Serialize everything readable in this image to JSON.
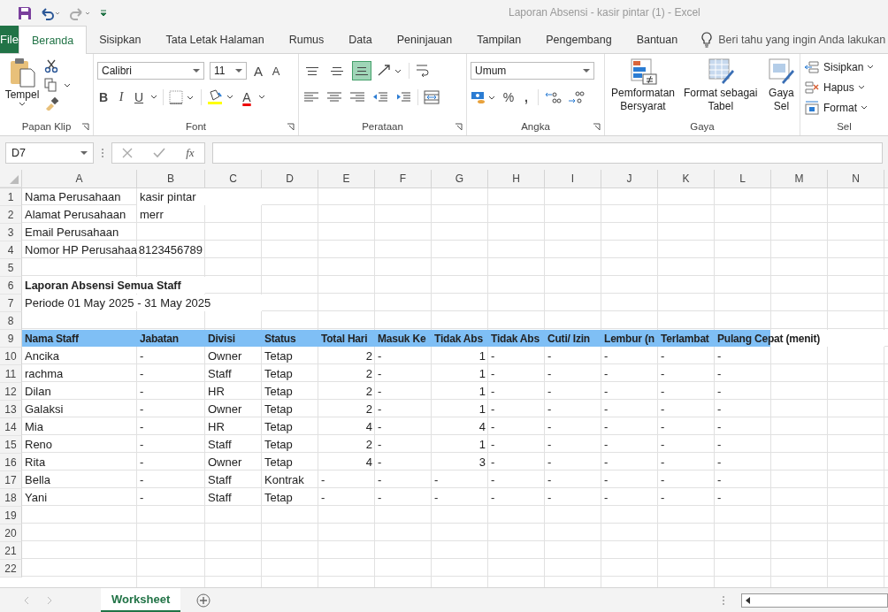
{
  "window": {
    "title": "Laporan Absensi - kasir pintar (1)  -  Excel"
  },
  "ribbon_tabs": [
    {
      "label": "File",
      "kind": "file",
      "selected": false
    },
    {
      "label": "Beranda",
      "kind": "tab",
      "selected": true
    },
    {
      "label": "Sisipkan",
      "kind": "tab",
      "selected": false
    },
    {
      "label": "Tata Letak Halaman",
      "kind": "tab",
      "selected": false
    },
    {
      "label": "Rumus",
      "kind": "tab",
      "selected": false
    },
    {
      "label": "Data",
      "kind": "tab",
      "selected": false
    },
    {
      "label": "Peninjauan",
      "kind": "tab",
      "selected": false
    },
    {
      "label": "Tampilan",
      "kind": "tab",
      "selected": false
    },
    {
      "label": "Pengembang",
      "kind": "tab",
      "selected": false
    },
    {
      "label": "Bantuan",
      "kind": "tab",
      "selected": false
    }
  ],
  "tell_me": {
    "placeholder": "Beri tahu yang ingin Anda lakukan"
  },
  "clipboard": {
    "label": "Papan Klip",
    "paste": "Tempel"
  },
  "font": {
    "label": "Font",
    "family": "Calibri",
    "size": "11",
    "grow": "A",
    "shrink": "A",
    "bold": "B",
    "italic": "I",
    "underline": "U",
    "font_color": "A"
  },
  "alignment": {
    "label": "Perataan",
    "vertical": [
      {
        "kind": "top",
        "selected": false
      },
      {
        "kind": "middle",
        "selected": false
      },
      {
        "kind": "bottom",
        "selected": true
      }
    ]
  },
  "number": {
    "label": "Angka",
    "format": "Umum",
    "percent": "%",
    "comma": ","
  },
  "styles": {
    "label": "Gaya",
    "buttons": [
      {
        "kind": "conditional",
        "lines": [
          "Pemformatan",
          "Bersyarat"
        ]
      },
      {
        "kind": "table",
        "lines": [
          "Format sebagai",
          "Tabel"
        ]
      },
      {
        "kind": "cell",
        "lines": [
          "Gaya",
          "Sel"
        ]
      }
    ]
  },
  "cells_group": {
    "label": "Sel",
    "buttons": [
      {
        "kind": "insert",
        "label": "Sisipkan"
      },
      {
        "kind": "delete",
        "label": "Hapus"
      },
      {
        "kind": "format",
        "label": "Format"
      }
    ]
  },
  "formula_bar": {
    "name_box": "D7",
    "fx": "fx"
  },
  "columns": [
    "A",
    "B",
    "C",
    "D",
    "E",
    "F",
    "G",
    "H",
    "I",
    "J",
    "K",
    "L",
    "M",
    "N"
  ],
  "rows": [
    {
      "n": "1",
      "kind": "plain",
      "cells": [
        "Nama Perusahaan",
        "kasir pintar"
      ]
    },
    {
      "n": "2",
      "kind": "plain",
      "cells": [
        "Alamat Perusahaan",
        "merr"
      ]
    },
    {
      "n": "3",
      "kind": "plain",
      "cells": [
        "Email Perusahaan"
      ]
    },
    {
      "n": "4",
      "kind": "plain",
      "cells": [
        "Nomor HP Perusahaa",
        "8123456789"
      ]
    },
    {
      "n": "5",
      "kind": "plain",
      "cells": []
    },
    {
      "n": "6",
      "kind": "title",
      "cells": [
        "Laporan Absensi Semua Staff"
      ]
    },
    {
      "n": "7",
      "kind": "plain",
      "cells": [
        "Periode 01 May 2025 - 31 May 2025"
      ]
    },
    {
      "n": "8",
      "kind": "plain",
      "cells": []
    },
    {
      "n": "9",
      "kind": "header",
      "cells": [
        "Nama Staff",
        "Jabatan",
        "Divisi",
        "Status",
        "Total Hari",
        "Masuk Ke",
        "Tidak Abs",
        "Tidak Abs",
        "Cuti/ Izin",
        "Lembur (n",
        "Terlambat",
        "Pulang Cepat (menit)"
      ]
    },
    {
      "n": "10",
      "kind": "plain",
      "cells": [
        "Ancika",
        "-",
        "Owner",
        "Tetap",
        "2",
        "-",
        "1",
        "-",
        "-",
        "-",
        "-",
        "-"
      ]
    },
    {
      "n": "11",
      "kind": "plain",
      "cells": [
        "rachma",
        "-",
        "Staff",
        "Tetap",
        "2",
        "-",
        "1",
        "-",
        "-",
        "-",
        "-",
        "-"
      ]
    },
    {
      "n": "12",
      "kind": "plain",
      "cells": [
        "Dilan",
        "-",
        "HR",
        "Tetap",
        "2",
        "-",
        "1",
        "-",
        "-",
        "-",
        "-",
        "-"
      ]
    },
    {
      "n": "13",
      "kind": "plain",
      "cells": [
        "Galaksi",
        "-",
        "Owner",
        "Tetap",
        "2",
        "-",
        "1",
        "-",
        "-",
        "-",
        "-",
        "-"
      ]
    },
    {
      "n": "14",
      "kind": "plain",
      "cells": [
        "Mia",
        "-",
        "HR",
        "Tetap",
        "4",
        "-",
        "4",
        "-",
        "-",
        "-",
        "-",
        "-"
      ]
    },
    {
      "n": "15",
      "kind": "plain",
      "cells": [
        "Reno",
        "-",
        "Staff",
        "Tetap",
        "2",
        "-",
        "1",
        "-",
        "-",
        "-",
        "-",
        "-"
      ]
    },
    {
      "n": "16",
      "kind": "plain",
      "cells": [
        "Rita",
        "-",
        "Owner",
        "Tetap",
        "4",
        "-",
        "3",
        "-",
        "-",
        "-",
        "-",
        "-"
      ]
    },
    {
      "n": "17",
      "kind": "plain",
      "cells": [
        "Bella",
        "-",
        "Staff",
        "Kontrak",
        "-",
        "-",
        "-",
        "-",
        "-",
        "-",
        "-",
        "-"
      ]
    },
    {
      "n": "18",
      "kind": "plain",
      "cells": [
        "Yani",
        "-",
        "Staff",
        "Tetap",
        "-",
        "-",
        "-",
        "-",
        "-",
        "-",
        "-",
        "-"
      ]
    },
    {
      "n": "19",
      "kind": "plain",
      "cells": []
    },
    {
      "n": "20",
      "kind": "plain",
      "cells": []
    },
    {
      "n": "21",
      "kind": "plain",
      "cells": []
    },
    {
      "n": "22",
      "kind": "plain",
      "cells": []
    }
  ],
  "sheet_tabs": [
    {
      "label": "Worksheet",
      "selected": true
    }
  ]
}
